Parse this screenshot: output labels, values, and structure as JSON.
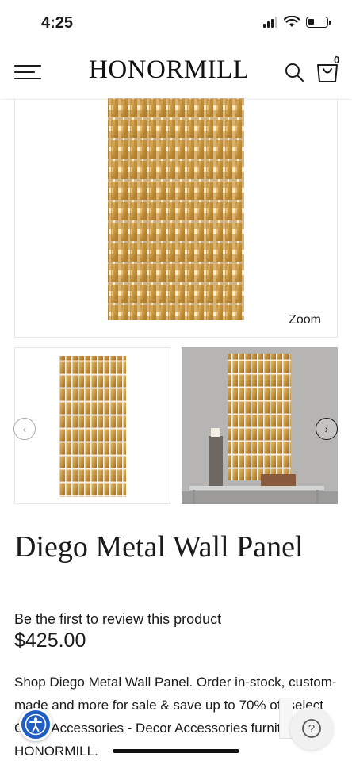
{
  "status_bar": {
    "time": "4:25",
    "icons": [
      "cellular-signal-icon",
      "wifi-icon",
      "battery-icon"
    ]
  },
  "header": {
    "brand": "HONORMILL",
    "cart_count": "0",
    "icons": [
      "hamburger-menu-icon",
      "search-icon",
      "shopping-bag-icon"
    ]
  },
  "gallery": {
    "zoom_label": "Zoom",
    "thumbnails": [
      "product-photo",
      "room-scene-photo"
    ],
    "prev_icon": "chevron-left-icon",
    "next_icon": "chevron-right-icon"
  },
  "product": {
    "title": "Diego Metal Wall Panel",
    "review_link": "Be the first to review this product",
    "price": "$425.00",
    "description": "Shop Diego Metal Wall Panel. Order in-stock, custom-made and more for sale & save up to 70% off select Other Accessories - Decor Accessories furniture at HONORMILL."
  },
  "floating": {
    "accessibility_icon": "accessibility-icon",
    "help_label": "?"
  },
  "colors": {
    "accent_blue": "#1f5cc4",
    "panel_gold": "#c8963e",
    "scene_gray": "#b7b5b3"
  }
}
